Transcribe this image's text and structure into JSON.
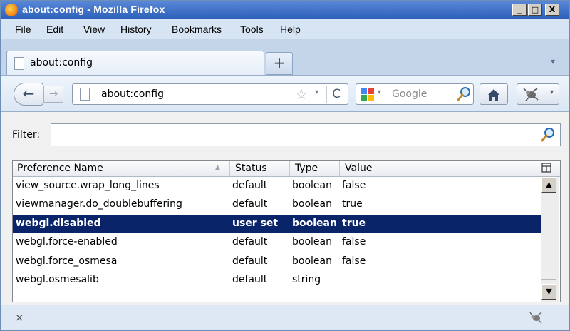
{
  "window": {
    "title": "about:config - Mozilla Firefox",
    "minimize_label": "_",
    "maximize_label": "□",
    "close_label": "X"
  },
  "menu": {
    "items": [
      {
        "label": "File"
      },
      {
        "label": "Edit"
      },
      {
        "label": "View"
      },
      {
        "label": "History"
      },
      {
        "label": "Bookmarks"
      },
      {
        "label": "Tools"
      },
      {
        "label": "Help"
      }
    ]
  },
  "tabs": {
    "active_label": "about:config",
    "new_tab_label": "+",
    "list_all_label": "▾"
  },
  "navbar": {
    "back_label": "←",
    "forward_label": "→",
    "url": "about:config",
    "bookmark_star": "☆",
    "url_dropdown": "▾",
    "reload_label": "C",
    "search_engine_dropdown": "▾",
    "search_placeholder": "Google",
    "addon_dropdown": "▾"
  },
  "filter": {
    "label": "Filter:",
    "value": ""
  },
  "prefs": {
    "columns": {
      "name": "Preference Name",
      "status": "Status",
      "type": "Type",
      "value": "Value"
    },
    "sort_indicator": "▲",
    "rows": [
      {
        "name": "view_source.wrap_long_lines",
        "status": "default",
        "type": "boolean",
        "value": "false"
      },
      {
        "name": "viewmanager.do_doublebuffering",
        "status": "default",
        "type": "boolean",
        "value": "true"
      },
      {
        "name": "webgl.disabled",
        "status": "user set",
        "type": "boolean",
        "value": "true"
      },
      {
        "name": "webgl.force-enabled",
        "status": "default",
        "type": "boolean",
        "value": "false"
      },
      {
        "name": "webgl.force_osmesa",
        "status": "default",
        "type": "boolean",
        "value": "false"
      },
      {
        "name": "webgl.osmesalib",
        "status": "default",
        "type": "string",
        "value": ""
      }
    ],
    "scroll_up": "▲",
    "scroll_down": "▼"
  },
  "statusbar": {
    "close_label": "×"
  },
  "colors": {
    "titlebar": "#3a6cc4",
    "selection": "#0a246a",
    "chrome": "#d6e4f3"
  }
}
